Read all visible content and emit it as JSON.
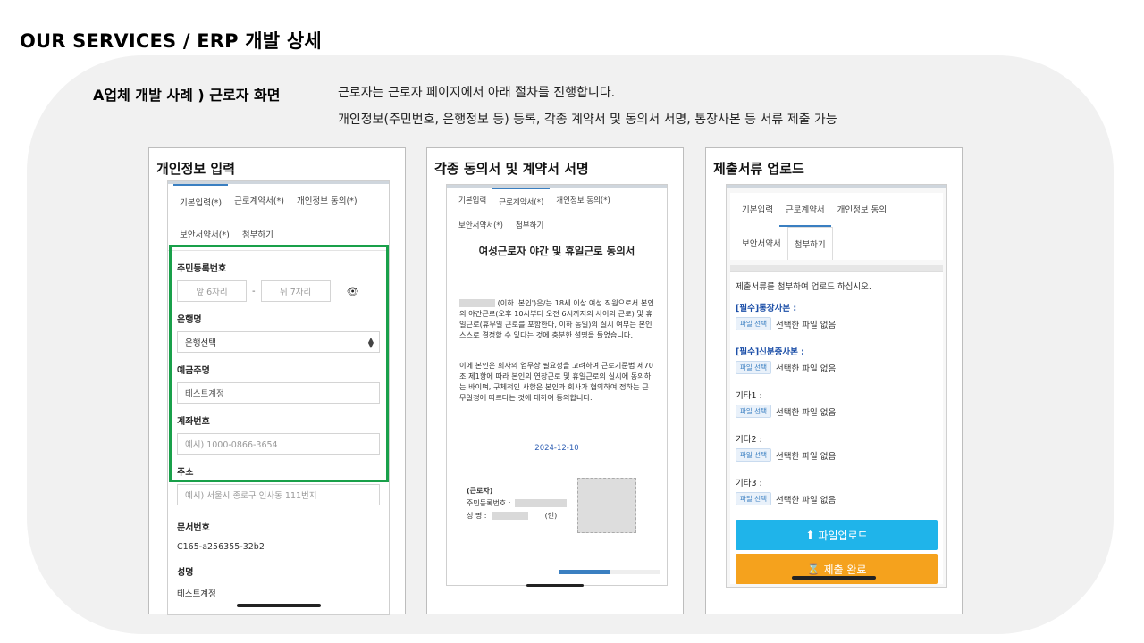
{
  "header": {
    "title": "OUR SERVICES / ERP 개발 상세"
  },
  "case": {
    "title": "A업체 개발 사례 ) 근로자 화면",
    "desc1": "근로자는 근로자 페이지에서 아래 절차를 진행합니다.",
    "desc2": "개인정보(주민번호, 은행정보 등) 등록, 각종 계약서 및 동의서 서명, 통장사본 등 서류 제출 가능"
  },
  "card1": {
    "title": "개인정보 입력",
    "tabs": [
      "기본입력(*)",
      "근로계약서(*)",
      "개인정보 동의(*)",
      "보안서약서(*)",
      "첨부하기"
    ],
    "resident_label": "주민등록번호",
    "resident_front_placeholder": "앞 6자리",
    "resident_dash": "-",
    "resident_back_placeholder": "뒤 7자리",
    "bank_label": "은행명",
    "bank_value": "은행선택",
    "holder_label": "예금주명",
    "holder_value": "테스트계정",
    "account_label": "계좌번호",
    "account_placeholder": "예시) 1000-0866-3654",
    "address_label": "주소",
    "address_placeholder": "예시) 서울시 종로구 인사동 111번지",
    "docno_label": "문서번호",
    "docno_value": "C165-a256355-32b2",
    "name_label": "성명",
    "name_value": "테스트계정"
  },
  "card2": {
    "title": "각종 동의서 및 계약서 서명",
    "tabs": [
      "기본입력",
      "근로계약서(*)",
      "개인정보 동의(*)",
      "보안서약서(*)",
      "첨부하기"
    ],
    "doc_title": "여성근로자 야간 및 휴일근로 동의서",
    "para1_lead": "(이하 '본인')은/는 18세 이상 여성 직원으로서",
    "para1_rest": "본인의 야간근로(오후 10시부터 오전 6시까지의 사이의 근로) 및 휴일근로(휴무일 근로를 포함한다, 이하 동일)의 실시 여부는 본인 스스로 결정할 수 있다는 것에 충분한 설명을 들었습니다.",
    "para2": "이에 본인은 회사의 업무상 필요성을 고려하여 근로기준법 제70조 제1항에 따라 본인의 연장근로 및 휴일근로의 실시에 동의하는 바이며, 구체적인 사항은 본인과 회사가 협의하여 정하는 근무일정에 따르다는 것에 대하여 동의합니다.",
    "date": "2024-12-10",
    "worker_label": "(근로자)",
    "resident_label": "주민등록번호 :",
    "name_label": "성 명 :",
    "seal": "(인)"
  },
  "card3": {
    "title": "제출서류 업로드",
    "tabs": [
      "기본입력",
      "근로계약서",
      "개인정보 동의",
      "보안서약서",
      "첨부하기"
    ],
    "message": "제출서류를 첨부하여 업로드 하십시오.",
    "items": [
      {
        "label": "[필수]통장사본 :",
        "required": true
      },
      {
        "label": "[필수]신분증사본 :",
        "required": true
      },
      {
        "label": "기타1 :",
        "required": false
      },
      {
        "label": "기타2 :",
        "required": false
      },
      {
        "label": "기타3 :",
        "required": false
      }
    ],
    "file_button": "파일 선택",
    "file_status": "선택한 파일 없음",
    "upload_button": "파일업로드",
    "submit_button": "제출 완료"
  },
  "colors": {
    "highlight": "#19a04a",
    "upload": "#1fb4ea",
    "submit": "#f5a21d",
    "accent": "#3a7fc1"
  }
}
